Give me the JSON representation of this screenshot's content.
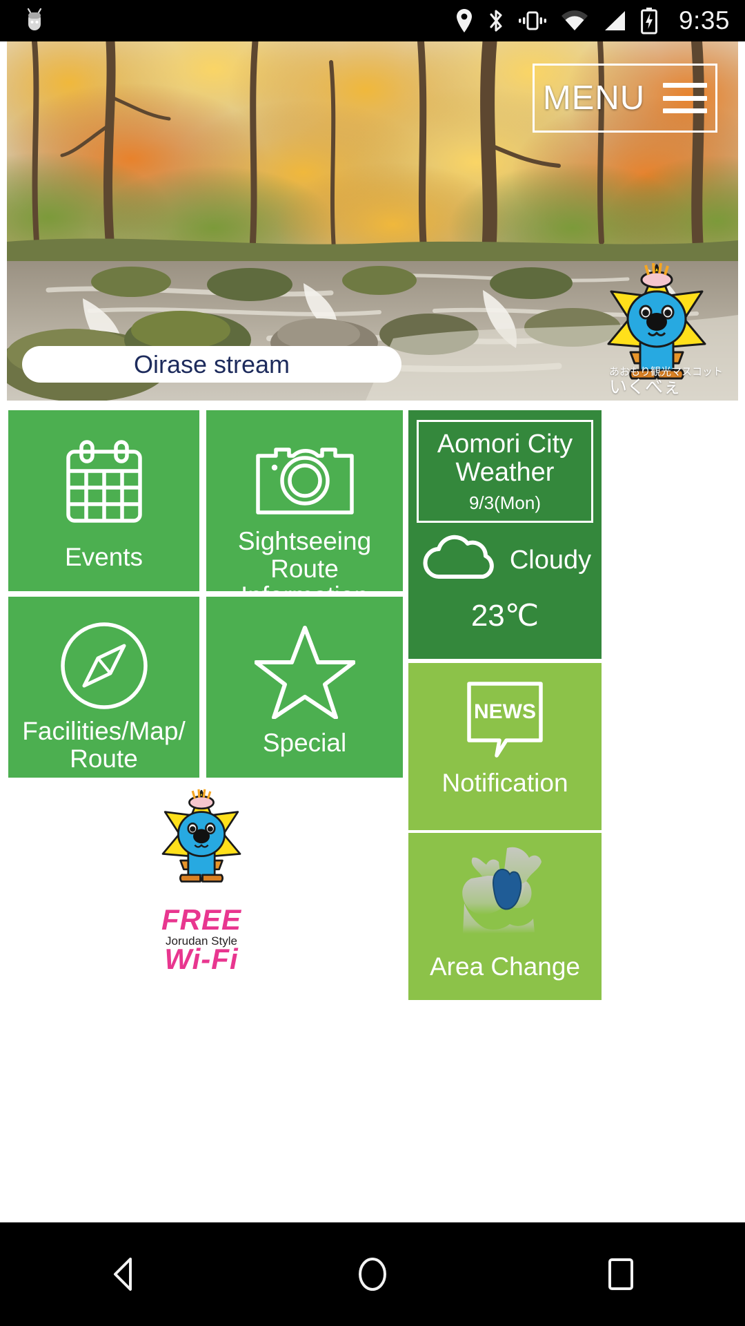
{
  "status_bar": {
    "time": "9:35",
    "icons": [
      "android-head-icon",
      "location-icon",
      "bluetooth-icon",
      "vibrate-icon",
      "wifi-icon",
      "signal-icon",
      "battery-charging-icon"
    ]
  },
  "hero": {
    "photo_alt": "oirase-stream-autumn-forest",
    "menu_label": "MENU",
    "menu_icon": "hamburger-icon",
    "caption": "Oirase stream",
    "mascot_icon": "ikubee-mascot",
    "mascot_caption_line1": "あおもり観光マスコット",
    "mascot_caption_line2": "いくべぇ"
  },
  "tiles": [
    {
      "id": "events",
      "label": "Events",
      "icon": "calendar-icon"
    },
    {
      "id": "sightseeing",
      "label": "Sightseeing Route\nInformation",
      "icon": "camera-icon"
    },
    {
      "id": "facilities",
      "label": "Facilities/Map/\nRoute",
      "icon": "compass-icon"
    },
    {
      "id": "special",
      "label": "Special",
      "icon": "star-icon"
    }
  ],
  "weather": {
    "title": "Aomori City\nWeather",
    "date": "9/3(Mon)",
    "icon": "cloud-icon",
    "condition": "Cloudy",
    "temperature": "23℃"
  },
  "notification": {
    "badge": "NEWS",
    "icon": "speech-bubble-icon",
    "label": "Notification"
  },
  "area_change": {
    "icon": "aomori-prefecture-map-icon",
    "label": "Area Change"
  },
  "free_wifi": {
    "mascot_icon": "ikubee-mascot",
    "line_top": "FREE",
    "line_mid": "Jorudan Style",
    "line_bottom": "Wi-Fi"
  },
  "nav_bar": {
    "back": "back-icon",
    "home": "home-icon",
    "recents": "recents-icon"
  },
  "colors": {
    "tile_green": "#4caf50",
    "weather_green": "#34883c",
    "panel_green": "#8cc249",
    "caption_text": "#1d2b5c",
    "wifi_magenta": "#e8368f"
  }
}
